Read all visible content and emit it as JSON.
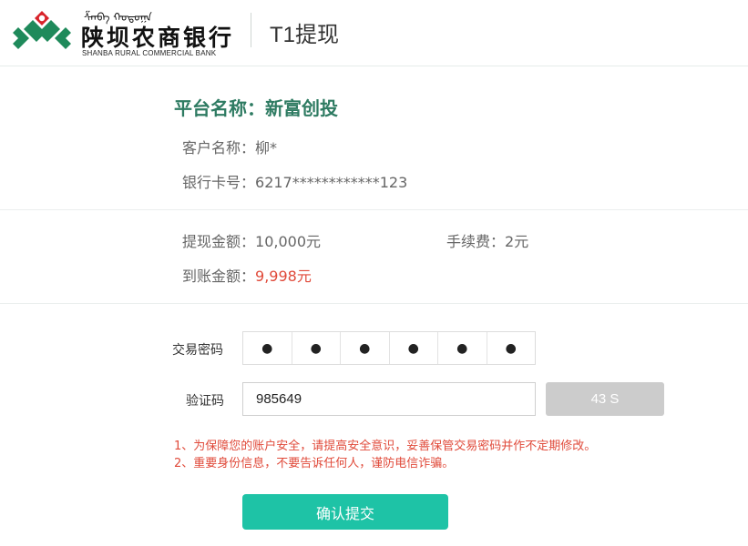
{
  "header": {
    "bank_name_mongolian": "ᠱᠠᠨᠪᠠ ᠬᠤᠳᠤᠭᠠ",
    "bank_name_cn": "陕坝农商银行",
    "bank_name_en": "SHANBA RURAL COMMERCIAL BANK",
    "page_title": "T1提现"
  },
  "info": {
    "platform_name": "平台名称：新富创投",
    "customer_label": "客户名称：",
    "customer_value": "柳*",
    "card_label": "银行卡号：",
    "card_value": "6217************123"
  },
  "amounts": {
    "withdraw_label": "提现金额：",
    "withdraw_value": "10,000元",
    "fee_label": "手续费：",
    "fee_value": "2元",
    "received_label": "到账金额：",
    "received_value": "9,998元"
  },
  "form": {
    "password_label": "交易密码",
    "password_digits": [
      "●",
      "●",
      "●",
      "●",
      "●",
      "●"
    ],
    "code_label": "验证码",
    "code_value": "985649",
    "countdown_label": "43 S"
  },
  "notices": [
    "1、为保障您的账户安全，请提高安全意识，妥善保管交易密码并作不定期修改。",
    "2、重要身份信息，不要告诉任何人，谨防电信诈骗。"
  ],
  "submit_label": "确认提交",
  "colors": {
    "brand_green": "#2e7b62",
    "accent_teal": "#1ec3a6",
    "warning_red": "#e04a3a"
  }
}
